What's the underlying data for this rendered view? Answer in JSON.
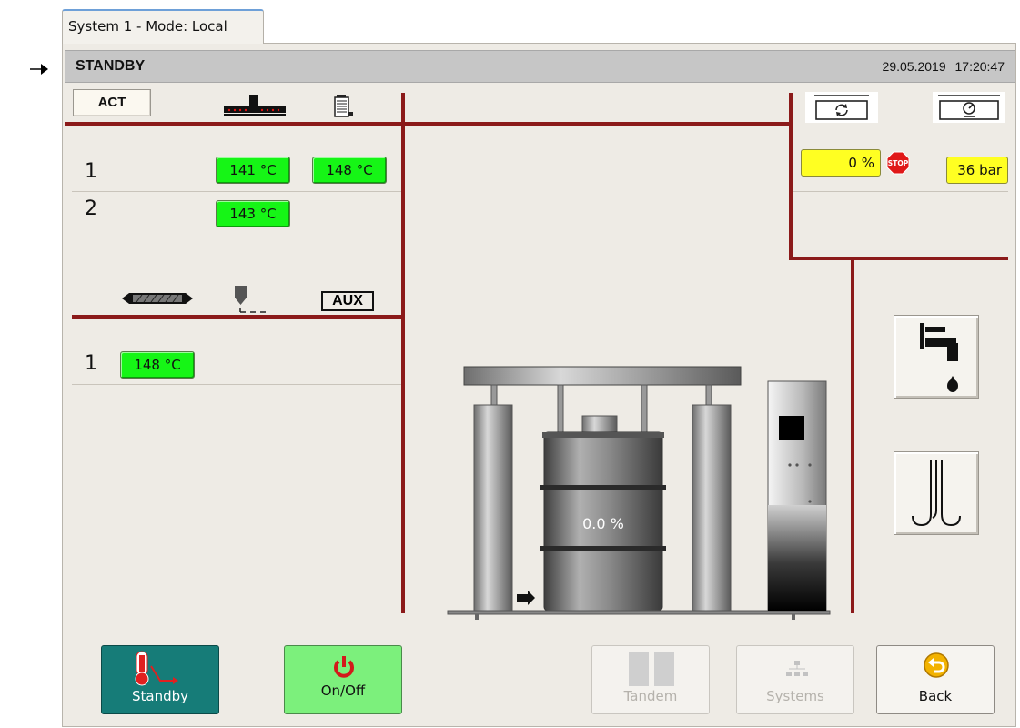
{
  "tab": {
    "label": "System 1 - Mode: Local"
  },
  "status": {
    "state": "STANDBY",
    "date": "29.05.2019",
    "time": "17:20:47"
  },
  "act": {
    "label": "ACT"
  },
  "hoses": {
    "rows": [
      {
        "num": "1",
        "values": [
          "141 °C",
          "148 °C"
        ]
      },
      {
        "num": "2",
        "values": [
          "143 °C"
        ]
      }
    ]
  },
  "aux_section": {
    "aux_label": "AUX",
    "rows": [
      {
        "num": "1",
        "values": [
          "148 °C"
        ]
      }
    ]
  },
  "pump": {
    "level": "0 %",
    "pressure": "36 bar"
  },
  "drum": {
    "fill_label": "0.0 %",
    "fill_fraction": 0.0
  },
  "buttons": {
    "standby": "Standby",
    "onoff": "On/Off",
    "tandem": "Tandem",
    "systems": "Systems",
    "back": "Back"
  },
  "colors": {
    "accent_line": "#8b1a1a",
    "temp_ok": "#16f516",
    "warning": "#ffff22",
    "standby_btn": "#167c78"
  },
  "icons": [
    "arrow-right-icon",
    "heater-bar-icon",
    "tank-icon",
    "hose-icon",
    "nozzle-icon",
    "refresh-icon",
    "gauge-icon",
    "stop-sign-icon",
    "faucet-icon",
    "heating-coil-icon",
    "thermometer-icon",
    "power-icon",
    "tandem-icon",
    "systems-icon",
    "back-arrow-icon"
  ]
}
